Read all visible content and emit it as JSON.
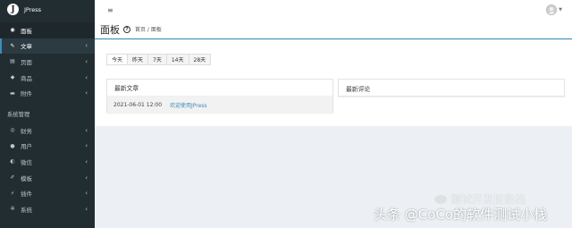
{
  "brand": {
    "logo_letter": "J",
    "name": "JPress"
  },
  "sidebar": {
    "items": [
      {
        "label": "面板",
        "icon": "dashboard-icon",
        "glyph": "◉",
        "state": "active",
        "has_chevron": false
      },
      {
        "label": "文章",
        "icon": "edit-icon",
        "glyph": "✎",
        "state": "open",
        "has_chevron": true
      },
      {
        "label": "页面",
        "icon": "file-icon",
        "glyph": "▤",
        "state": "",
        "has_chevron": true
      },
      {
        "label": "商品",
        "icon": "tag-icon",
        "glyph": "◆",
        "state": "",
        "has_chevron": true
      },
      {
        "label": "附件",
        "icon": "folder-icon",
        "glyph": "▬",
        "state": "",
        "has_chevron": true
      }
    ],
    "section_header": "系统管理",
    "system_items": [
      {
        "label": "财务",
        "icon": "finance-icon",
        "glyph": "◎",
        "has_chevron": true
      },
      {
        "label": "用户",
        "icon": "user-icon",
        "glyph": "●",
        "has_chevron": true
      },
      {
        "label": "微信",
        "icon": "wechat-icon",
        "glyph": "◐",
        "has_chevron": true
      },
      {
        "label": "模板",
        "icon": "brush-icon",
        "glyph": "✐",
        "has_chevron": true
      },
      {
        "label": "插件",
        "icon": "plug-icon",
        "glyph": "⚡",
        "has_chevron": true
      },
      {
        "label": "系统",
        "icon": "gear-icon",
        "glyph": "✲",
        "has_chevron": true
      }
    ]
  },
  "topbar": {
    "menu_glyph": "≡"
  },
  "header": {
    "title": "面板",
    "help_glyph": "?",
    "breadcrumb": "首页 / 面板"
  },
  "date_tabs": [
    "今天",
    "昨天",
    "7天",
    "14天",
    "28天"
  ],
  "active_date_tab": 0,
  "articles_box": {
    "title": "最新文章",
    "rows": [
      {
        "date": "2021-06-01 12:00",
        "title": "欢迎使用JPress"
      }
    ]
  },
  "comments_box": {
    "title": "最新评论"
  },
  "watermark": {
    "line1": "测试开发技能栈",
    "line2": "头条 @CoCo的软件测试小栈"
  },
  "colors": {
    "sidebar_bg": "#222d32",
    "accent": "#3c8dbc",
    "content_bg": "#ecf0f5"
  }
}
